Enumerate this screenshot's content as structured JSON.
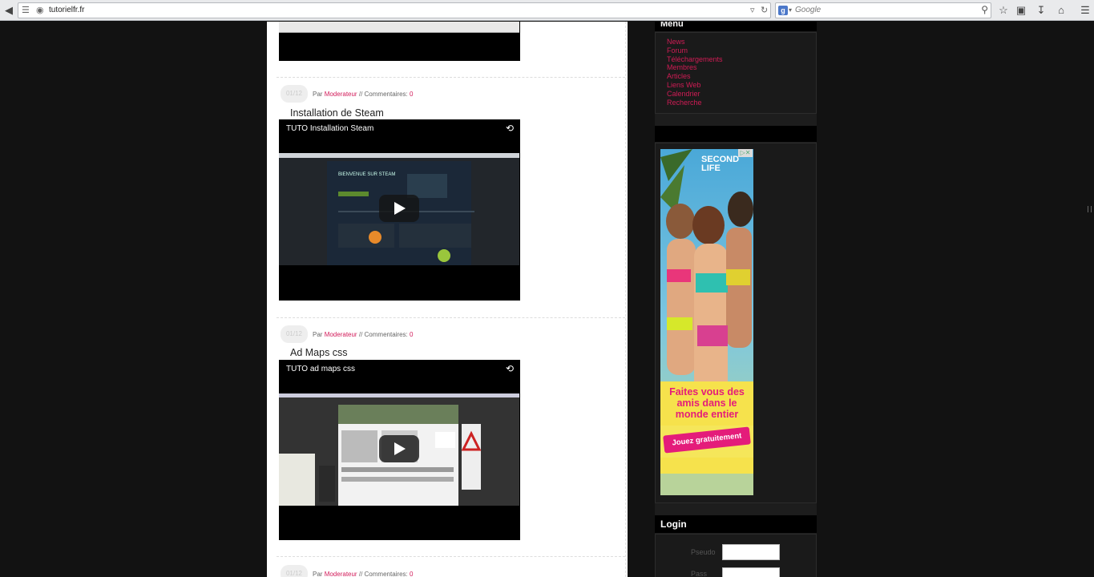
{
  "browser": {
    "url": "tutorielfr.fr",
    "search_engine_letter": "g",
    "search_placeholder": "Google"
  },
  "posts": [
    {
      "date": "01/12",
      "by_label": "Par",
      "author": "Moderateur",
      "comments_label": "// Commentaires:",
      "comments_count": "0",
      "title": "Installation de Steam",
      "video_title": "TUTO Installation Steam",
      "video_screen_heading": "BIENVENUE SUR STEAM"
    },
    {
      "date": "01/12",
      "by_label": "Par",
      "author": "Moderateur",
      "comments_label": "// Commentaires:",
      "comments_count": "0",
      "title": "Ad Maps css",
      "video_title": "TUTO ad maps css"
    },
    {
      "date": "01/12",
      "by_label": "Par",
      "author": "Moderateur",
      "comments_label": "// Commentaires:",
      "comments_count": "0"
    }
  ],
  "sidebar": {
    "menu_title": "Menu",
    "menu_items": [
      "News",
      "Forum",
      "Téléchargements",
      "Membres",
      "Articles",
      "Liens Web",
      "Calendrier",
      "Recherche"
    ],
    "ad": {
      "brand": "SECOND LIFE",
      "headline": "Faites vous des amis dans le monde entier",
      "cta": "Jouez gratuitement"
    },
    "login_title": "Login",
    "login_fields": [
      "Pseudo",
      "Pass"
    ]
  },
  "colors": {
    "link": "#d21b5a",
    "page_bg": "#121212",
    "sidebar_bg": "#1d1d1d"
  }
}
